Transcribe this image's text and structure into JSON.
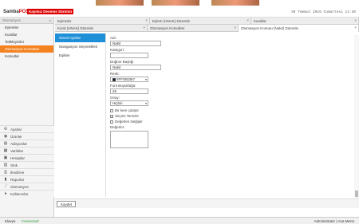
{
  "header": {
    "logo_brand": "Samba",
    "logo_suffix": "POS",
    "trial_badge": "Kayıtsız Deneme Sürümü",
    "datetime": "30 Temmuz 2016 Cumartesi 11:30"
  },
  "sidebar": {
    "header": "Otomasyon",
    "items": [
      {
        "label": "Eylemler"
      },
      {
        "label": "Kurallar"
      },
      {
        "label": "Tetikleyiciler"
      },
      {
        "label": "Otomasyon Komutları",
        "active": true
      },
      {
        "label": "Komutlar"
      }
    ],
    "nav": [
      {
        "label": "Ayarlar",
        "icon": "gear-icon"
      },
      {
        "label": "Ürünler",
        "icon": "product-icon"
      },
      {
        "label": "Adisyonlar",
        "icon": "ticket-icon"
      },
      {
        "label": "Varlıklar",
        "icon": "entity-icon"
      },
      {
        "label": "Hesaplar",
        "icon": "account-icon"
      },
      {
        "label": "Stok",
        "icon": "stock-icon"
      },
      {
        "label": "İkndirme",
        "icon": "print-icon"
      },
      {
        "label": "Raporlar",
        "icon": "report-icon"
      },
      {
        "label": "Otomasyon",
        "icon": "automation-icon"
      },
      {
        "label": "Kullanıcılar",
        "icon": "user-icon"
      }
    ]
  },
  "tabs_row1": [
    {
      "label": "Eylemler"
    },
    {
      "label": "Eylem (HNAK) Düzenle"
    },
    {
      "label": "Kurallar"
    }
  ],
  "tabs_row2": [
    {
      "label": "Kural (HNAK) Düzenle"
    },
    {
      "label": "Otomasyon Komutları"
    },
    {
      "label": "Otomasyon Komutu (Nakit) Düzenle"
    }
  ],
  "settings_nav": [
    {
      "label": "Genel Ayarlar",
      "active": true
    },
    {
      "label": "Navigasyon Seçenekleri"
    },
    {
      "label": "Eşikler"
    }
  ],
  "form": {
    "name_label": "Adı:",
    "name_value": "Nakit",
    "category_label": "Kategori:",
    "category_value": "",
    "button_header_label": "Düğme Başlığı",
    "button_header_value": "Nakit",
    "color_label": "Renk:",
    "color_value": "#FF093367",
    "color_hex": "#001a36",
    "font_size_label": "Font Büyüklüğü:",
    "font_size_value": "26",
    "confirm_label": "Onay:",
    "confirm_value": "Hiçbiri",
    "run_once_label": "Bir kere çalıştır",
    "clear_selection_label": "Seçimi Temizle",
    "change_values_label": "Değerleri Değiştir",
    "values_label": "Değerler:"
  },
  "footer": {
    "save_label": "Kaydet"
  },
  "status": {
    "terminal": "Klavye",
    "connection": "Connected",
    "user": "Administrator",
    "menu": "Ana Menü"
  }
}
